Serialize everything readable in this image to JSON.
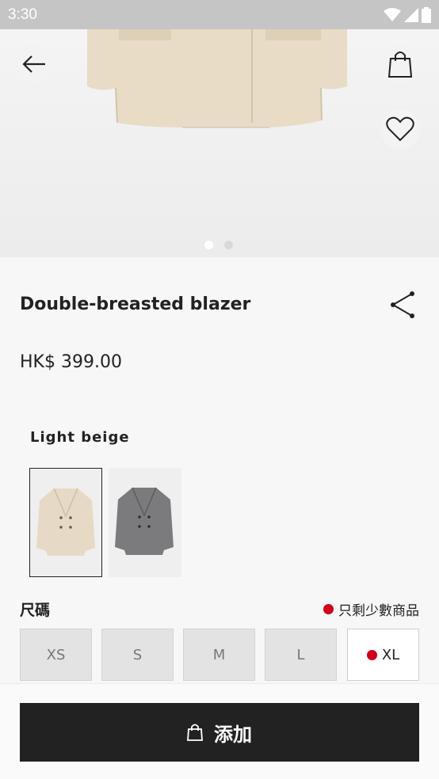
{
  "status_bar": {
    "time": "3:30"
  },
  "hero": {
    "carousel_pages": 2,
    "active_page": 0
  },
  "product": {
    "title": "Double-breasted blazer",
    "price": "HK$ 399.00",
    "color_name": "Light beige"
  },
  "swatches": [
    {
      "name": "Light beige",
      "color": "#e6dac6",
      "selected": true
    },
    {
      "name": "Grey",
      "color": "#7b7b7d",
      "selected": false
    }
  ],
  "sizes": {
    "label": "尺碼",
    "low_stock_note": "只剩少數商品",
    "items": [
      {
        "label": "XS",
        "available": false
      },
      {
        "label": "S",
        "available": false
      },
      {
        "label": "M",
        "available": false
      },
      {
        "label": "L",
        "available": false
      },
      {
        "label": "XL",
        "available": true,
        "low_stock": true
      }
    ]
  },
  "cta": {
    "add_label": "添加"
  },
  "icons": {
    "back": "arrow-left-icon",
    "bag": "shopping-bag-icon",
    "wishlist": "heart-icon",
    "share": "share-icon",
    "cta": "shopping-bag-icon"
  },
  "colors": {
    "low_stock": "#d0021b",
    "cta_bg": "#222222"
  }
}
